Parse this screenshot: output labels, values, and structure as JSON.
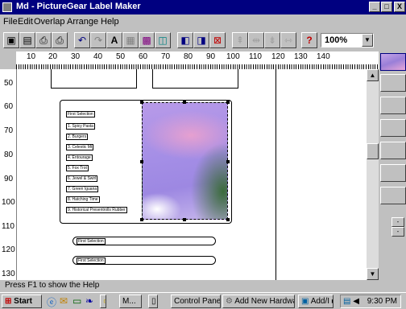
{
  "window": {
    "title": "Md - PictureGear Label Maker",
    "buttons": [
      "_",
      "□",
      "X"
    ]
  },
  "menu": [
    "File",
    "Edit",
    "Overlap",
    "Arrange",
    "Help"
  ],
  "toolbar": {
    "zoom_value": "100%"
  },
  "ruler": {
    "labels": [
      "10",
      "20",
      "30",
      "40",
      "50",
      "60",
      "70",
      "80",
      "90",
      "100",
      "110",
      "120",
      "130",
      "140"
    ]
  },
  "vruler": {
    "labels": [
      "50",
      "60",
      "70",
      "80",
      "90",
      "100",
      "110",
      "120",
      "130"
    ]
  },
  "label": {
    "header": "First Selection",
    "items": [
      "1. Spicy Pasta",
      "2. Burgers",
      "3. Celestic Mt",
      "4. Entourage",
      "5. Fox Trot",
      "6. Jewel & Swirl",
      "7. Green Iguana",
      "8. Hatching Time",
      "9. Historical Presentrolls Rubber"
    ]
  },
  "pills": [
    "First Selection",
    "First Selection"
  ],
  "status": "Press F1 to show the Help",
  "taskbar": {
    "start": "Start",
    "tasks": [
      "M...",
      "Control Panel",
      "Add New Hardware",
      "Add/I ▸"
    ],
    "clock": "9:30 PM"
  }
}
